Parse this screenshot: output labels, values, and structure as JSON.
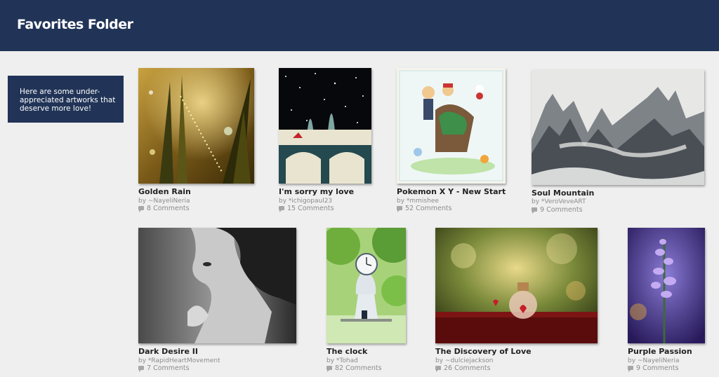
{
  "header": {
    "title": "Favorites Folder"
  },
  "infobox": {
    "text": "Here are some under-appreciated artworks that deserve more love!"
  },
  "artworks": [
    {
      "title": "Golden Rain",
      "by": "by ~NayeliNeria",
      "comments": "8 Comments",
      "image": "golden-grass-drops"
    },
    {
      "title": "I'm sorry my love",
      "by": "by *ichigopaul23",
      "comments": "15 Comments",
      "image": "night-bridge"
    },
    {
      "title": "Pokemon X Y - New Start",
      "by": "by *mmishee",
      "comments": "52 Comments",
      "image": "pokemon-illustration"
    },
    {
      "title": "Soul Mountain",
      "by": "by *VeroVeveART",
      "comments": "9 Comments",
      "image": "ink-mountains"
    },
    {
      "title": "Dark Desire II",
      "by": "by *RapidHeartMovement",
      "comments": "7 Comments",
      "image": "bw-portrait"
    },
    {
      "title": "The clock",
      "by": "by *Tohad",
      "comments": "82 Comments",
      "image": "park-clock"
    },
    {
      "title": "The Discovery of Love",
      "by": "by ~dulciejackson",
      "comments": "26 Comments",
      "image": "heart-bottle"
    },
    {
      "title": "Purple Passion",
      "by": "by ~NayeliNeria",
      "comments": "9 Comments",
      "image": "purple-flower"
    }
  ]
}
